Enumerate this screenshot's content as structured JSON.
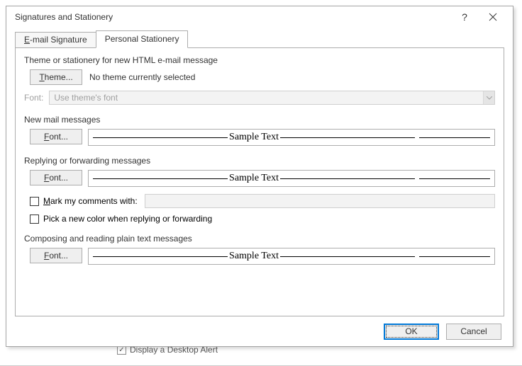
{
  "dialog": {
    "title": "Signatures and Stationery",
    "help": "?"
  },
  "tabs": {
    "email_sig_prefix": "E",
    "email_sig_rest": "-mail Signature",
    "personal": "Personal Stationery"
  },
  "theme_section": {
    "label": "Theme or stationery for new HTML e-mail message",
    "theme_btn_prefix": "T",
    "theme_btn_rest": "heme...",
    "status": "No theme currently selected",
    "font_label": "Font:",
    "font_value": "Use theme's font"
  },
  "new_mail": {
    "label": "New mail messages",
    "font_btn_prefix": "F",
    "font_btn_rest": "ont...",
    "sample": "Sample Text"
  },
  "reply": {
    "label": "Replying or forwarding messages",
    "font_btn_prefix": "F",
    "font_btn_rest": "ont...",
    "sample": "Sample Text",
    "mark_prefix": "M",
    "mark_rest": "ark my comments with:",
    "pick_color": "Pick a new color when replying or forwarding"
  },
  "plain": {
    "label": "Composing and reading plain text messages",
    "font_btn_prefix": "F",
    "font_btn_rest": "ont...",
    "sample": "Sample Text"
  },
  "footer": {
    "ok": "OK",
    "cancel": "Cancel"
  },
  "background": {
    "bottom_checkbox": "Display a Desktop Alert"
  }
}
